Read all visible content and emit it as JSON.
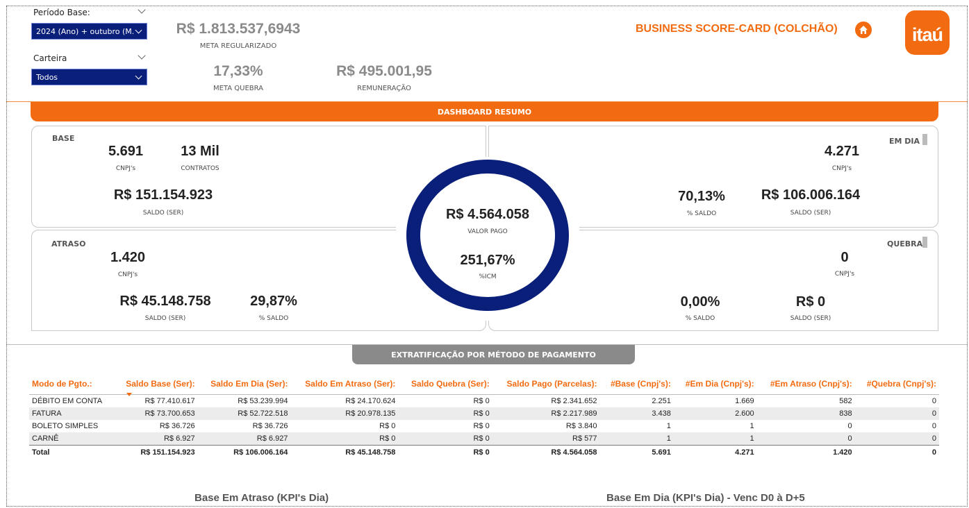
{
  "filters": {
    "periodo_label": "Período Base:",
    "periodo_value": "2024 (Ano) + outubro (M...",
    "carteira_label": "Carteira",
    "carteira_value": "Todos"
  },
  "header_kpis": {
    "meta_regularizado_value": "R$ 1.813.537,6943",
    "meta_regularizado_label": "META REGULARIZADO",
    "meta_quebra_value": "17,33%",
    "meta_quebra_label": "META QUEBRA",
    "remuneracao_value": "R$ 495.001,95",
    "remuneracao_label": "REMUNERAÇÃO"
  },
  "title": "BUSINESS SCORE-CARD (COLCHÃO)",
  "logo_text": "itaú",
  "banner": "DASHBOARD RESUMO",
  "base": {
    "title": "BASE",
    "cnpj_value": "5.691",
    "cnpj_label": "CNPJ's",
    "contratos_value": "13 Mil",
    "contratos_label": "CONTRATOS",
    "saldo_value": "R$ 151.154.923",
    "saldo_label": "SALDO (SER)"
  },
  "atraso": {
    "title": "ATRASO",
    "cnpj_value": "1.420",
    "cnpj_label": "CNPJ's",
    "saldo_value": "R$ 45.148.758",
    "saldo_label": "SALDO (SER)",
    "pct_value": "29,87%",
    "pct_label": "% SALDO"
  },
  "em_dia": {
    "title": "EM DIA",
    "cnpj_value": "4.271",
    "cnpj_label": "CNPJ's",
    "pct_value": "70,13%",
    "pct_label": "% SALDO",
    "saldo_value": "R$ 106.006.164",
    "saldo_label": "SALDO (SER)"
  },
  "quebra": {
    "title": "QUEBRA",
    "cnpj_value": "0",
    "cnpj_label": "CNPJ's",
    "pct_value": "0,00%",
    "pct_label": "% SALDO",
    "saldo_value": "R$ 0",
    "saldo_label": "SALDO (SER)"
  },
  "center": {
    "valor_pago_value": "R$ 4.564.058",
    "valor_pago_label": "VALOR PAGO",
    "icm_value": "251,67%",
    "icm_label": "%ICM",
    "ring_color": "#0a1f7a"
  },
  "extrat_banner": "EXTRATIFICAÇÃO POR MÉTODO DE PAGAMENTO",
  "table": {
    "headers": [
      "Modo de Pgto.:",
      "Saldo Base (Ser):",
      "Saldo Em Dia (Ser):",
      "Saldo Em Atraso (Ser):",
      "Saldo Quebra (Ser):",
      "Saldo Pago (Parcelas):",
      "#Base (Cnpj's):",
      "#Em Dia (Cnpj's):",
      "#Em Atraso (Cnpj's):",
      "#Quebra (Cnpj's):"
    ],
    "rows": [
      [
        "DÉBITO EM CONTA",
        "R$ 77.410.617",
        "R$ 53.239.994",
        "R$ 24.170.624",
        "R$ 0",
        "R$ 2.341.652",
        "2.251",
        "1.669",
        "582",
        "0"
      ],
      [
        "FATURA",
        "R$ 73.700.653",
        "R$ 52.722.518",
        "R$ 20.978.135",
        "R$ 0",
        "R$ 2.217.989",
        "3.438",
        "2.600",
        "838",
        "0"
      ],
      [
        "BOLETO SIMPLES",
        "R$ 36.726",
        "R$ 36.726",
        "R$ 0",
        "R$ 0",
        "R$ 3.840",
        "1",
        "1",
        "0",
        "0"
      ],
      [
        "CARNÊ",
        "R$ 6.927",
        "R$ 6.927",
        "R$ 0",
        "R$ 0",
        "R$ 577",
        "1",
        "1",
        "0",
        "0"
      ]
    ],
    "total": [
      "Total",
      "R$ 151.154.923",
      "R$ 106.006.164",
      "R$ 45.148.758",
      "R$ 0",
      "R$ 4.564.058",
      "5.691",
      "4.271",
      "1.420",
      "0"
    ]
  },
  "bottom": {
    "left_title": "Base Em Atraso (KPI's Dia)",
    "right_title": "Base Em Dia (KPI's Dia) - Venc D0 à D+5"
  },
  "colors": {
    "accent": "#f26b10",
    "navy": "#0a1f7a",
    "gray": "#8a8a8a"
  },
  "icons": {
    "home": "home-icon",
    "chevron": "chevron-down-icon"
  }
}
